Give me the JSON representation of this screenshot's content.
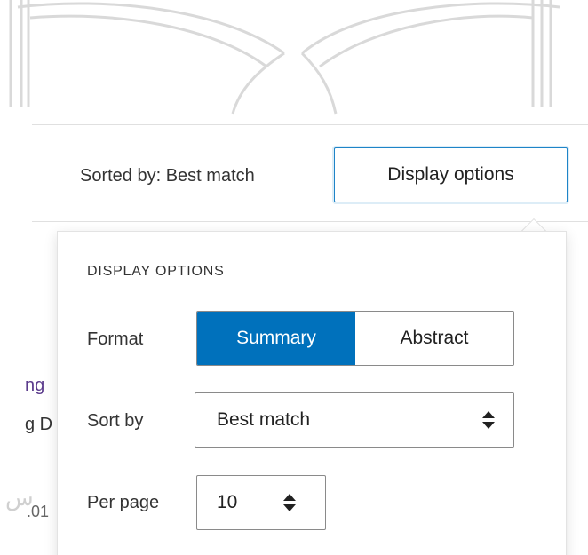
{
  "toolbar": {
    "sorted_by": "Sorted by: Best match",
    "display_options_button": "Display options"
  },
  "background_results": {
    "partial_link": "ng",
    "partial_text": "g D",
    "partial_number": ".01"
  },
  "display_options_panel": {
    "title": "DISPLAY OPTIONS",
    "format": {
      "label": "Format",
      "options": [
        "Summary",
        "Abstract"
      ],
      "selected": "Summary"
    },
    "sort_by": {
      "label": "Sort by",
      "value": "Best match"
    },
    "per_page": {
      "label": "Per page",
      "value": "10"
    }
  },
  "icons": {
    "select_arrows": "up-down-arrows-icon",
    "background_logo": "book-logo"
  },
  "colors": {
    "accent": "#0071bc",
    "focus_border": "#1e84c8",
    "visited_link": "#5b3b8c"
  }
}
